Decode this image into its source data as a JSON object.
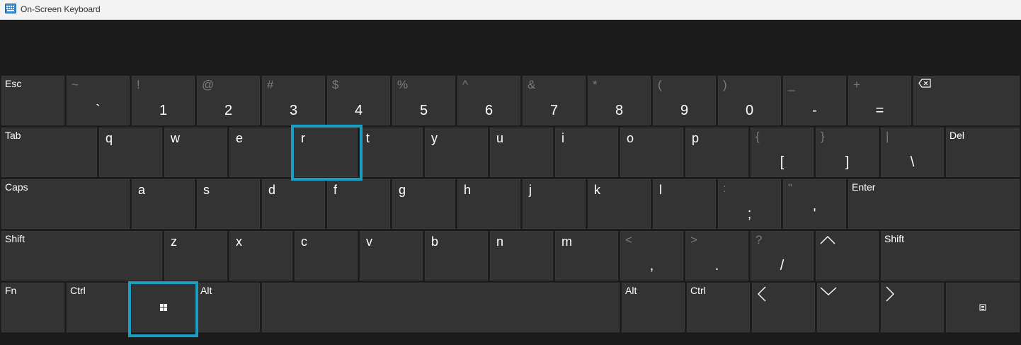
{
  "window": {
    "title": "On-Screen Keyboard"
  },
  "keys": {
    "esc": "Esc",
    "tilde": "~",
    "backtick": "`",
    "excl": "!",
    "one": "1",
    "at": "@",
    "two": "2",
    "hash": "#",
    "three": "3",
    "dollar": "$",
    "four": "4",
    "percent": "%",
    "five": "5",
    "caret": "^",
    "six": "6",
    "amp": "&",
    "seven": "7",
    "star": "*",
    "eight": "8",
    "lparen": "(",
    "nine": "9",
    "rparen": ")",
    "zero": "0",
    "underscore": "_",
    "minus": "-",
    "plus": "+",
    "equals": "=",
    "tab": "Tab",
    "q": "q",
    "w": "w",
    "e": "e",
    "r": "r",
    "t": "t",
    "y": "y",
    "u": "u",
    "i": "i",
    "o": "o",
    "p": "p",
    "lbrace": "{",
    "lbracket": "[",
    "rbrace": "}",
    "rbracket": "]",
    "pipe": "|",
    "backslash": "\\",
    "del": "Del",
    "caps": "Caps",
    "a": "a",
    "s": "s",
    "d": "d",
    "f": "f",
    "g": "g",
    "h": "h",
    "j": "j",
    "k": "k",
    "l": "l",
    "colon": ":",
    "semicolon": ";",
    "dquote": "\"",
    "squote": "'",
    "enter": "Enter",
    "shift": "Shift",
    "z": "z",
    "x": "x",
    "c": "c",
    "v": "v",
    "b": "b",
    "n": "n",
    "m": "m",
    "lt": "<",
    "comma": ",",
    "gt": ">",
    "period": ".",
    "question": "?",
    "slash": "/",
    "fn": "Fn",
    "ctrl": "Ctrl",
    "alt": "Alt"
  },
  "icons": {
    "app": "keyboard-icon",
    "backspace": "backspace-icon",
    "windows": "windows-logo-icon",
    "up": "arrow-up-icon",
    "left": "arrow-left-icon",
    "down": "arrow-down-icon",
    "right": "arrow-right-icon",
    "menu": "context-menu-icon"
  },
  "highlighted_keys": [
    "r",
    "windows"
  ],
  "colors": {
    "key": "#333333",
    "background": "#1c1c1c",
    "highlight": "#1a9fc2",
    "shift_char": "#7b7b7b"
  }
}
